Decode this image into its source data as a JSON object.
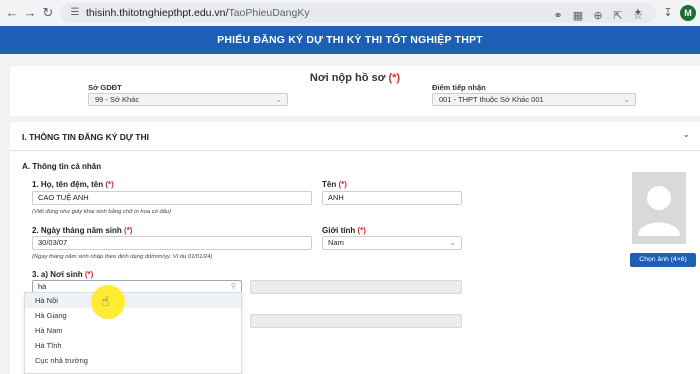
{
  "browser": {
    "url_host": "thisinh.thitotnghiepthpt.edu.vn/",
    "url_path": "TaoPhieuDangKy",
    "profile_initial": "M"
  },
  "header": {
    "title": "PHIẾU ĐĂNG KÝ DỰ THI KỲ THI TỐT NGHIỆP THPT"
  },
  "submit_place": {
    "title": "Nơi nộp hồ sơ",
    "required_mark": "(*)",
    "department_label": "Sở GDĐT",
    "department_value": "99 - Sở Khác",
    "receive_point_label": "Điểm tiếp nhận",
    "receive_point_value": "001 - THPT thuộc Sở Khác 001"
  },
  "section": {
    "title": "I. THÔNG TIN ĐĂNG KÝ DỰ THI",
    "personal_title": "A. Thông tin cá nhân",
    "fullname_label": "1. Họ, tên đệm, tên",
    "fullname_value": "CAO TUỆ ANH",
    "fullname_hint": "(Viết đúng như giấy khai sinh bằng chữ in hoa có dấu)",
    "firstname_label": "Tên",
    "firstname_value": "ANH",
    "dob_label": "2. Ngày tháng năm sinh",
    "dob_value": "30/03/07",
    "dob_hint": "(Ngày tháng năm sinh nhập theo định dạng dd/mm/yy. Ví dụ 01/01/24)",
    "gender_label": "Giới tính",
    "gender_value": "Nam",
    "birthplace_label": "3. a) Nơi sinh",
    "birthplace_search": "hà",
    "req": "(*)",
    "photo_button": "Chọn ảnh (4×6)"
  },
  "dropdown": {
    "options": [
      "Hà Nội",
      "Hà Giang",
      "Hà Nam",
      "Hà Tĩnh",
      "Cục nhà trường"
    ]
  }
}
